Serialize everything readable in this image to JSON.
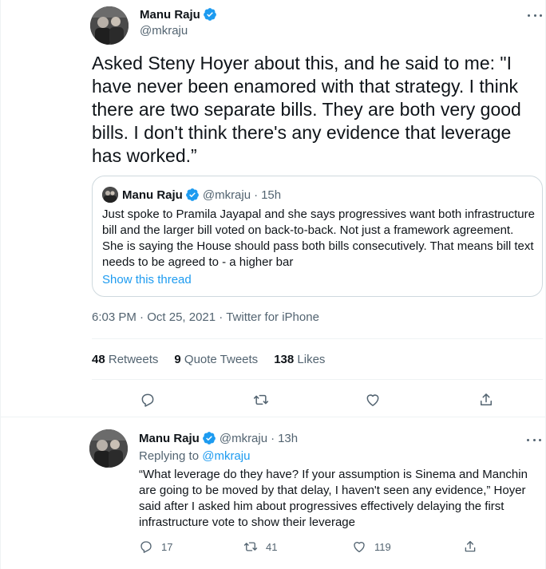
{
  "tweet": {
    "author": {
      "name": "Manu Raju",
      "handle": "@mkraju"
    },
    "text": "Asked Steny Hoyer about this, and he said to me: \"I have never been enamored with that strategy. I think there are two separate bills. They are both very good bills. I don't think there's any evidence that leverage has worked.”",
    "quote": {
      "name": "Manu Raju",
      "handle": "@mkraju",
      "sep": "·",
      "time": "15h",
      "text": "Just spoke to Pramila Jayapal and she says progressives want both infrastructure bill and the larger bill voted on back-to-back. Not just a framework agreement. She is saying the House should pass both bills consecutively. That means bill text needs to be agreed to - a higher bar",
      "show_thread": "Show this thread"
    },
    "meta": {
      "time": "6:03 PM",
      "sep1": "·",
      "date": "Oct 25, 2021",
      "sep2": "·",
      "source": "Twitter for iPhone"
    },
    "stats": {
      "retweets_count": "48",
      "retweets_label": "Retweets",
      "quotes_count": "9",
      "quotes_label": "Quote Tweets",
      "likes_count": "138",
      "likes_label": "Likes"
    },
    "actions": [
      "reply-icon",
      "retweet-icon",
      "like-icon",
      "share-icon"
    ]
  },
  "reply": {
    "author": {
      "name": "Manu Raju",
      "handle": "@mkraju",
      "sep": "·",
      "time": "13h"
    },
    "replying_prefix": "Replying to",
    "replying_to": "@mkraju",
    "text": "“What leverage do they have? If your assumption is Sinema and Manchin are going to be moved by that delay, I haven't seen any evidence,” Hoyer said after I asked him about progressives effectively delaying the first infrastructure vote to show their leverage",
    "counts": {
      "replies": "17",
      "retweets": "41",
      "likes": "119"
    }
  },
  "colors": {
    "accent": "#1d9bf0",
    "muted": "#536471",
    "text": "#0f1419",
    "border": "#cfd9de"
  }
}
